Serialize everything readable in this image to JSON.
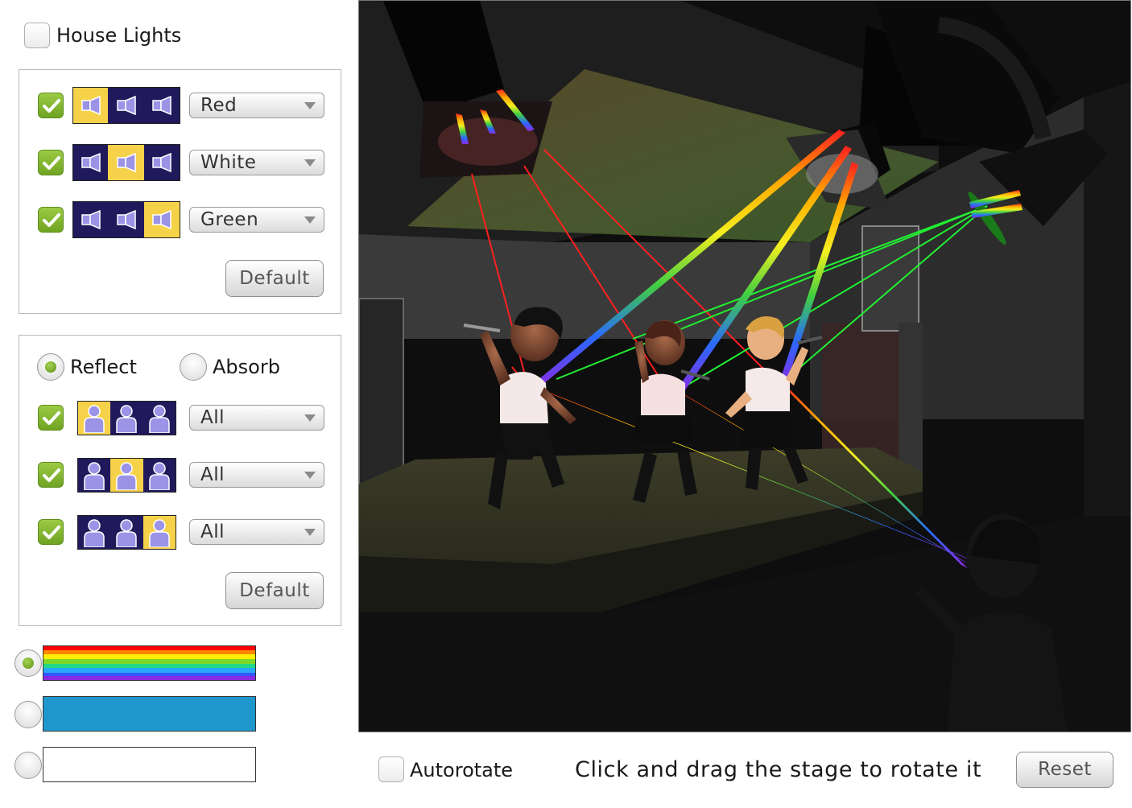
{
  "house_lights": {
    "label": "House Lights",
    "checked": false
  },
  "lights": {
    "rows": [
      {
        "enabled": true,
        "selected_index": 0,
        "color": "Red"
      },
      {
        "enabled": true,
        "selected_index": 1,
        "color": "White"
      },
      {
        "enabled": true,
        "selected_index": 2,
        "color": "Green"
      }
    ],
    "default_label": "Default"
  },
  "surface": {
    "reflect_label": "Reflect",
    "absorb_label": "Absorb",
    "mode": "Reflect",
    "rows": [
      {
        "enabled": true,
        "selected_index": 0,
        "value": "All"
      },
      {
        "enabled": true,
        "selected_index": 1,
        "value": "All"
      },
      {
        "enabled": true,
        "selected_index": 2,
        "value": "All"
      }
    ],
    "default_label": "Default"
  },
  "beam_display": {
    "options": [
      "rainbow",
      "blue",
      "white"
    ],
    "selected": "rainbow",
    "colors": {
      "blue": "#1f97cc",
      "white": "#ffffff"
    }
  },
  "bottom": {
    "autorotate_label": "Autorotate",
    "autorotate_checked": false,
    "instruction": "Click and drag the stage to rotate it",
    "reset_label": "Reset"
  },
  "colors": {
    "accent_green": "#7ab32e",
    "strip_bg": "#201a5c",
    "strip_selected": "#f6d24a",
    "red_beam": "#ff1a1a",
    "green_beam": "#22ee33"
  }
}
